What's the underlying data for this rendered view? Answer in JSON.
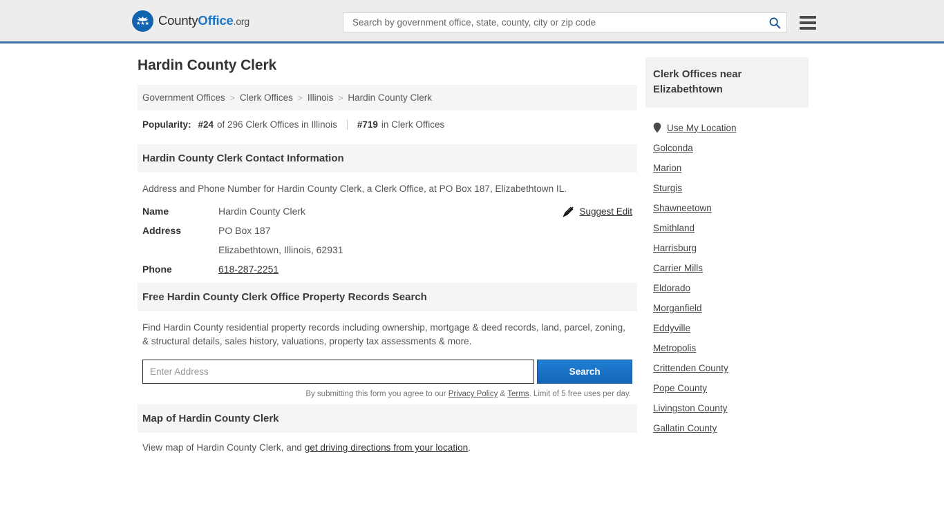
{
  "header": {
    "logo": {
      "text_county": "County",
      "text_office": "Office",
      "text_org": ".org",
      "icon": "eagle-seal-icon"
    },
    "search": {
      "placeholder": "Search by government office, state, county, city or zip code",
      "value": "",
      "icon": "search-icon"
    },
    "menu_icon": "hamburger-menu-icon"
  },
  "page": {
    "title": "Hardin County Clerk"
  },
  "breadcrumb": {
    "items": [
      {
        "label": "Government Offices"
      },
      {
        "label": "Clerk Offices"
      },
      {
        "label": "Illinois"
      },
      {
        "label": "Hardin County Clerk"
      }
    ],
    "separator": ">"
  },
  "popularity": {
    "label": "Popularity:",
    "rank_state": "#24",
    "rank_state_rest": "of 296 Clerk Offices in Illinois",
    "rank_national": "#719",
    "rank_national_rest": "in Clerk Offices"
  },
  "contact": {
    "heading": "Hardin County Clerk Contact Information",
    "description": "Address and Phone Number for Hardin County Clerk, a Clerk Office, at PO Box 187, Elizabethtown IL.",
    "rows": [
      {
        "label": "Name",
        "value": "Hardin County Clerk"
      },
      {
        "label": "Address",
        "value": "PO Box 187"
      },
      {
        "label": "",
        "value": "Elizabethtown, Illinois, 62931"
      },
      {
        "label": "Phone",
        "value": "618-287-2251"
      }
    ],
    "suggest_edit": {
      "label": "Suggest Edit",
      "icon": "edit-pencil-icon"
    }
  },
  "property_search": {
    "heading": "Free Hardin County Clerk Office Property Records Search",
    "description": "Find Hardin County residential property records including ownership, mortgage & deed records, land, parcel, zoning, & structural details, sales history, valuations, property tax assessments & more.",
    "input_placeholder": "Enter Address",
    "input_value": "",
    "button_label": "Search",
    "disclaimer_pre": "By submitting this form you agree to our",
    "privacy_label": "Privacy Policy",
    "amp": "&",
    "terms_label": "Terms",
    "disclaimer_post": ". Limit of 5 free uses per day."
  },
  "map": {
    "heading": "Map of Hardin County Clerk",
    "description_pre": "View map of Hardin County Clerk, and",
    "link_label": "get driving directions from your location",
    "description_post": "."
  },
  "sidebar": {
    "heading": "Clerk Offices near Elizabethtown",
    "use_my_location": {
      "label": "Use My Location",
      "icon": "map-pin-icon"
    },
    "items": [
      {
        "label": "Golconda"
      },
      {
        "label": "Marion"
      },
      {
        "label": "Sturgis"
      },
      {
        "label": "Shawneetown"
      },
      {
        "label": "Smithland"
      },
      {
        "label": "Harrisburg"
      },
      {
        "label": "Carrier Mills"
      },
      {
        "label": "Eldorado"
      },
      {
        "label": "Morganfield"
      },
      {
        "label": "Eddyville"
      },
      {
        "label": "Metropolis"
      },
      {
        "label": "Crittenden County"
      },
      {
        "label": "Pope County"
      },
      {
        "label": "Livingston County"
      },
      {
        "label": "Gallatin County"
      }
    ]
  },
  "colors": {
    "brand_blue": "#1264b0",
    "header_bg": "#ededed",
    "header_border": "#3a6ea5",
    "section_bg": "#f5f5f5",
    "button_blue": "#1565b8",
    "search_icon": "#1a4d8f"
  }
}
